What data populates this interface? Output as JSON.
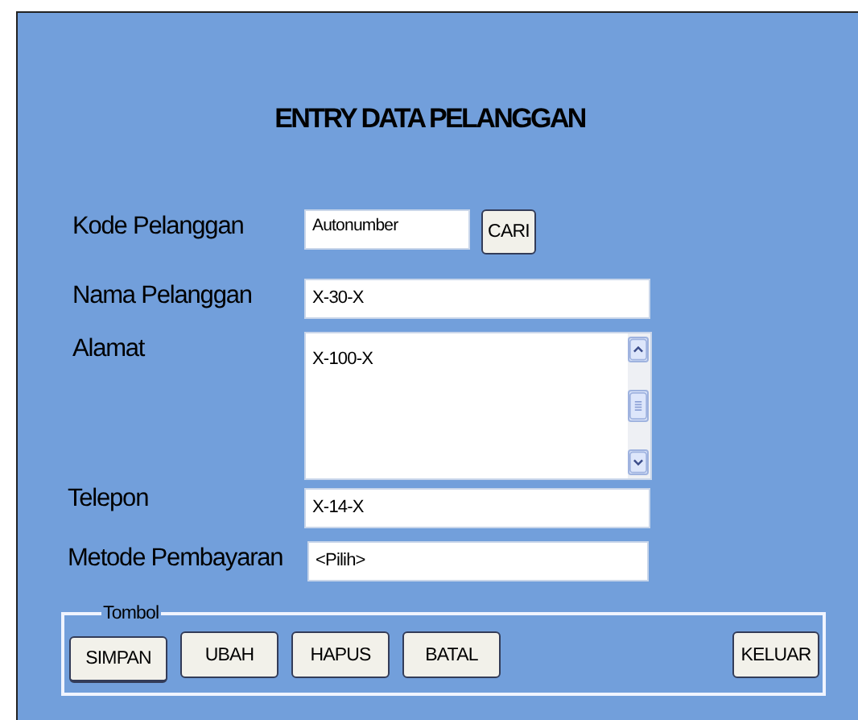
{
  "title": "ENTRY DATA PELANGGAN",
  "fields": [
    {
      "kind": "text-search",
      "label": "Kode Pelanggan",
      "value": "Autonumber",
      "button": "CARI"
    },
    {
      "kind": "text",
      "label": "Nama Pelanggan",
      "value": "X-30-X"
    },
    {
      "kind": "textarea",
      "label": "Alamat",
      "value": "X-100-X"
    },
    {
      "kind": "text",
      "label": "Telepon",
      "value": "X-14-X"
    },
    {
      "kind": "dropdown",
      "label": "Metode Pembayaran",
      "value": "<Pilih>"
    }
  ],
  "button_group": {
    "legend": "Tombol",
    "buttons": [
      {
        "label": "SIMPAN",
        "focused": true
      },
      {
        "label": "UBAH",
        "focused": false
      },
      {
        "label": "HAPUS",
        "focused": false
      },
      {
        "label": "BATAL",
        "focused": false
      },
      {
        "label": "KELUAR",
        "focused": false
      }
    ]
  }
}
